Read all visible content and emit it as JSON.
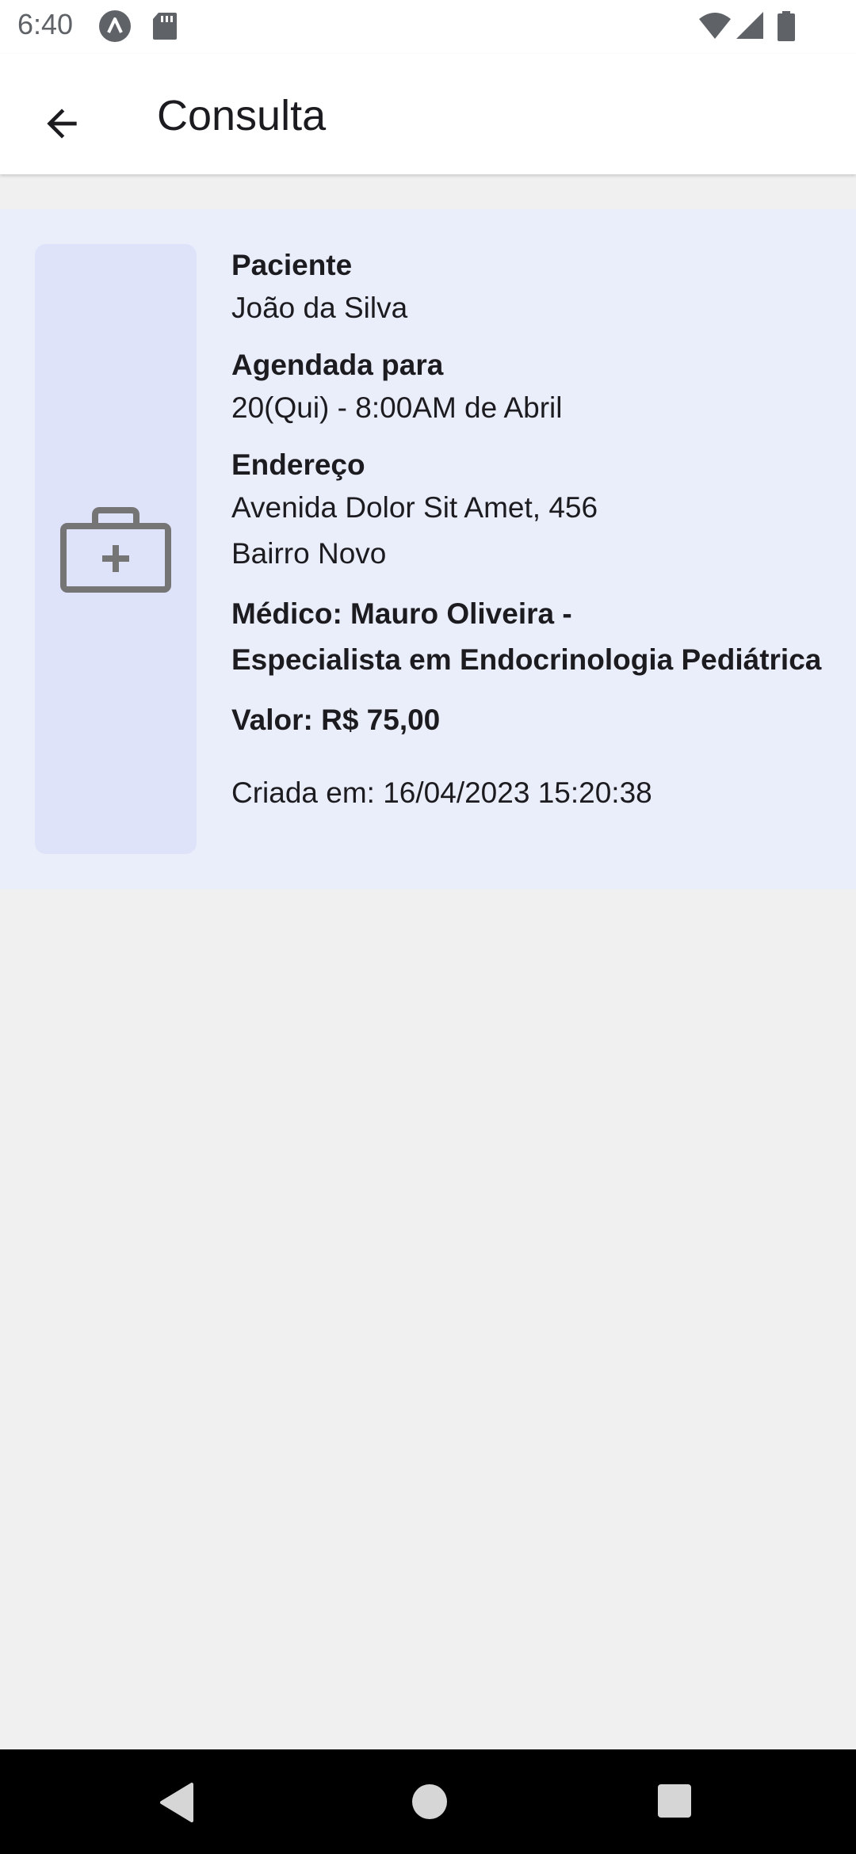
{
  "status_bar": {
    "time": "6:40",
    "icons": [
      "app-notification-icon",
      "sd-card-icon",
      "wifi-icon",
      "signal-icon",
      "battery-icon"
    ]
  },
  "app_bar": {
    "title": "Consulta",
    "back_icon": "arrow-back-icon"
  },
  "appointment": {
    "icon": "medical-kit-icon",
    "patient_label": "Paciente",
    "patient_name": "João da Silva",
    "scheduled_label": "Agendada para",
    "scheduled_value": "20(Qui) - 8:00AM de Abril",
    "address_label": "Endereço",
    "address_line1": "Avenida Dolor Sit Amet, 456",
    "address_line2": "Bairro Novo",
    "doctor_line1": "Médico: Mauro Oliveira -",
    "doctor_line2": "Especialista em Endocrinologia Pediátrica",
    "price": "Valor: R$ 75,00",
    "created_at": "Criada em: 16/04/2023 15:20:38"
  },
  "colors": {
    "card_background": "#eaeefa",
    "icon_panel_background": "#dfe3f9",
    "icon_color": "#757575",
    "page_background": "#f0f0f0"
  },
  "nav_bar": {
    "icons": [
      "nav-back-icon",
      "nav-home-icon",
      "nav-recents-icon"
    ]
  }
}
